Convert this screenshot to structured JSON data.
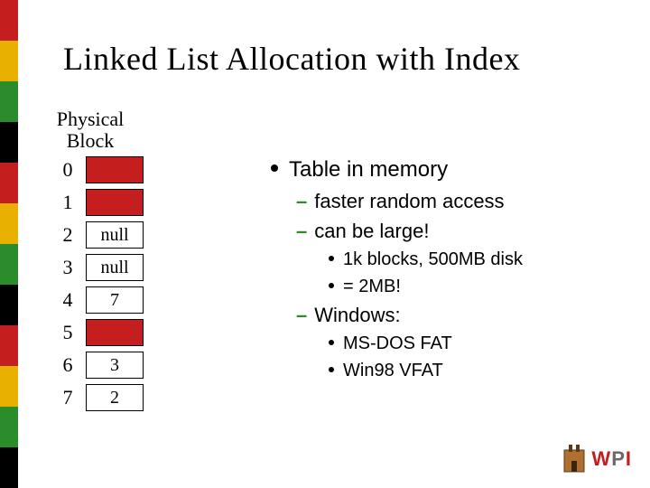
{
  "title": "Linked List Allocation with Index",
  "table": {
    "header_line1": "Physical",
    "header_line2": "Block",
    "rows": [
      {
        "index": "0",
        "value": ""
      },
      {
        "index": "1",
        "value": ""
      },
      {
        "index": "2",
        "value": "null"
      },
      {
        "index": "3",
        "value": "null"
      },
      {
        "index": "4",
        "value": "7"
      },
      {
        "index": "5",
        "value": ""
      },
      {
        "index": "6",
        "value": "3"
      },
      {
        "index": "7",
        "value": "2"
      }
    ]
  },
  "bullets": {
    "main": "Table in memory",
    "sub1": "faster random access",
    "sub2": "can be large!",
    "sub2a": "1k blocks, 500MB disk",
    "sub2b": "= 2MB!",
    "sub3": "Windows:",
    "sub3a": "MS-DOS FAT",
    "sub3b": "Win98 VFAT"
  },
  "logo": {
    "w": "W",
    "p": "P",
    "i": "I"
  }
}
